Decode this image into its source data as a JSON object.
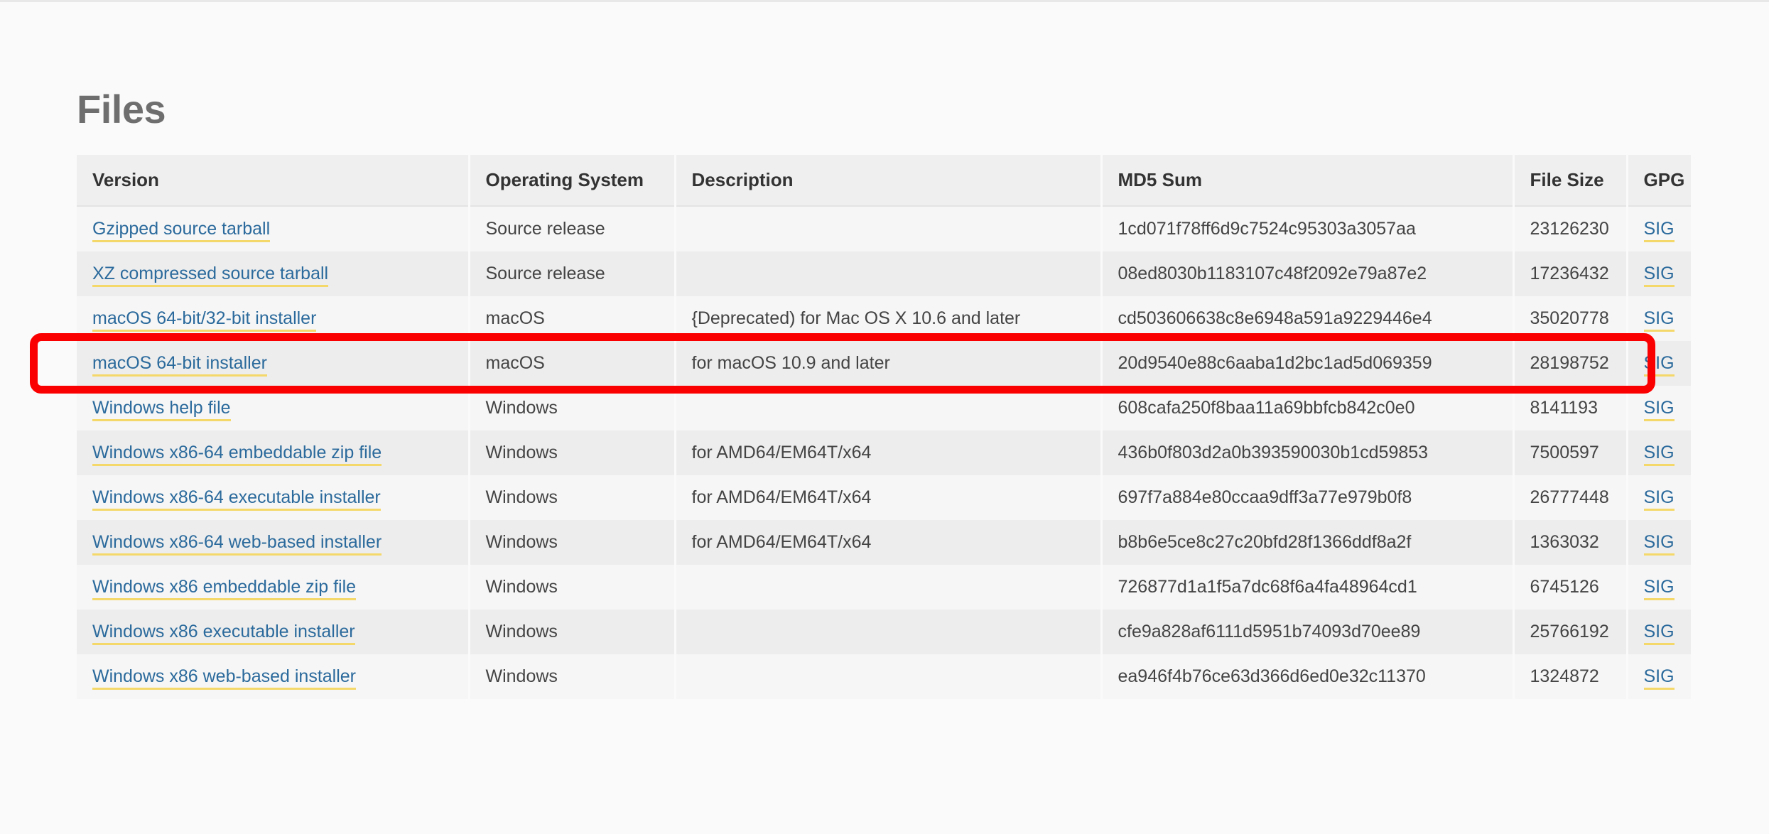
{
  "page": {
    "heading": "Files"
  },
  "table": {
    "columns": [
      {
        "key": "version",
        "label": "Version"
      },
      {
        "key": "os",
        "label": "Operating System"
      },
      {
        "key": "description",
        "label": "Description"
      },
      {
        "key": "md5",
        "label": "MD5 Sum"
      },
      {
        "key": "size",
        "label": "File Size"
      },
      {
        "key": "gpg",
        "label": "GPG"
      }
    ],
    "gpg_link_label": "SIG",
    "rows": [
      {
        "version": "Gzipped source tarball",
        "os": "Source release",
        "description": "",
        "md5": "1cd071f78ff6d9c7524c95303a3057aa",
        "size": "23126230",
        "gpg": "SIG",
        "highlighted": false
      },
      {
        "version": "XZ compressed source tarball",
        "os": "Source release",
        "description": "",
        "md5": "08ed8030b1183107c48f2092e79a87e2",
        "size": "17236432",
        "gpg": "SIG",
        "highlighted": false
      },
      {
        "version": "macOS 64-bit/32-bit installer",
        "os": "macOS",
        "description": "{Deprecated) for Mac OS X 10.6 and later",
        "md5": "cd503606638c8e6948a591a9229446e4",
        "size": "35020778",
        "gpg": "SIG",
        "highlighted": false
      },
      {
        "version": "macOS 64-bit installer",
        "os": "macOS",
        "description": "for macOS 10.9 and later",
        "md5": "20d9540e88c6aaba1d2bc1ad5d069359",
        "size": "28198752",
        "gpg": "SIG",
        "highlighted": true
      },
      {
        "version": "Windows help file",
        "os": "Windows",
        "description": "",
        "md5": "608cafa250f8baa11a69bbfcb842c0e0",
        "size": "8141193",
        "gpg": "SIG",
        "highlighted": false
      },
      {
        "version": "Windows x86-64 embeddable zip file",
        "os": "Windows",
        "description": "for AMD64/EM64T/x64",
        "md5": "436b0f803d2a0b393590030b1cd59853",
        "size": "7500597",
        "gpg": "SIG",
        "highlighted": false
      },
      {
        "version": "Windows x86-64 executable installer",
        "os": "Windows",
        "description": "for AMD64/EM64T/x64",
        "md5": "697f7a884e80ccaa9dff3a77e979b0f8",
        "size": "26777448",
        "gpg": "SIG",
        "highlighted": false
      },
      {
        "version": "Windows x86-64 web-based installer",
        "os": "Windows",
        "description": "for AMD64/EM64T/x64",
        "md5": "b8b6e5ce8c27c20bfd28f1366ddf8a2f",
        "size": "1363032",
        "gpg": "SIG",
        "highlighted": false
      },
      {
        "version": "Windows x86 embeddable zip file",
        "os": "Windows",
        "description": "",
        "md5": "726877d1a1f5a7dc68f6a4fa48964cd1",
        "size": "6745126",
        "gpg": "SIG",
        "highlighted": false
      },
      {
        "version": "Windows x86 executable installer",
        "os": "Windows",
        "description": "",
        "md5": "cfe9a828af6111d5951b74093d70ee89",
        "size": "25766192",
        "gpg": "SIG",
        "highlighted": false
      },
      {
        "version": "Windows x86 web-based installer",
        "os": "Windows",
        "description": "",
        "md5": "ea946f4b76ce63d366d6ed0e32c11370",
        "size": "1324872",
        "gpg": "SIG",
        "highlighted": false
      }
    ]
  },
  "annotation": {
    "highlight_color": "#fb0000",
    "target_row_version": "macOS 64-bit installer"
  },
  "colors": {
    "link": "#2b6a9c",
    "link_underline": "#f5d86a",
    "heading": "#6e6e6e",
    "page_background": "#fafafa",
    "header_background": "#efefef",
    "row_odd": "#f6f6f6",
    "row_even": "#ededed"
  }
}
